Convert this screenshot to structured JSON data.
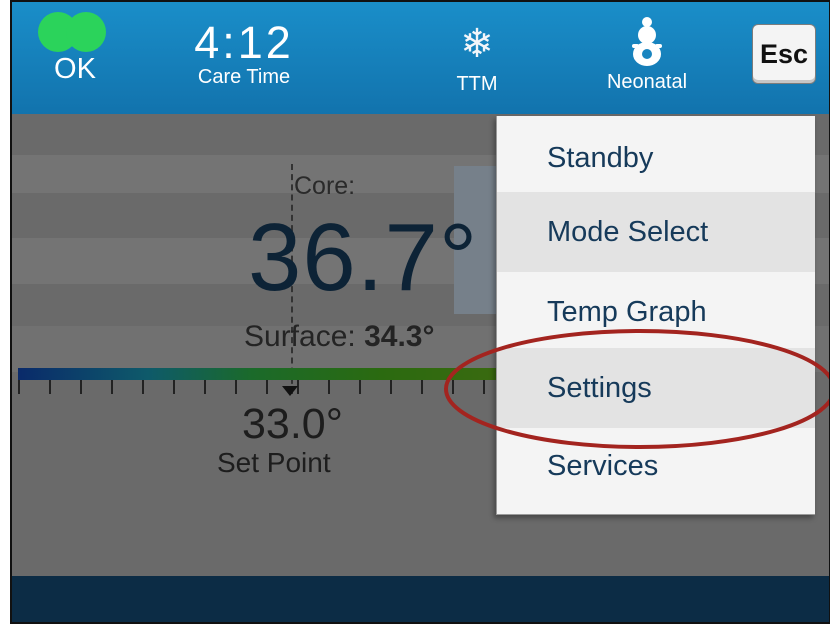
{
  "header": {
    "status_label": "OK",
    "status_color": "#2bd35b",
    "care_time_value": "4:12",
    "care_time_label": "Care Time",
    "mode_icon": "snowflake-icon",
    "mode_glyph": "❄",
    "mode_label": "TTM",
    "patient_icon": "baby-icon",
    "patient_label": "Neonatal",
    "esc_label": "Esc"
  },
  "main": {
    "core_label": "Core:",
    "core_value": "36.7°",
    "surface_label": "Surface:",
    "surface_value": "34.3°",
    "set_point_value": "33.0°",
    "set_point_label": "Set Point"
  },
  "menu": {
    "items": [
      {
        "label": "Standby"
      },
      {
        "label": "Mode Select"
      },
      {
        "label": "Temp Graph"
      },
      {
        "label": "Settings"
      },
      {
        "label": "Services"
      }
    ],
    "highlighted": "Settings",
    "highlight_color": "#a3241f"
  },
  "colors": {
    "header": "#1a8ec9",
    "bottom_bar": "#0c2c45",
    "menu_text": "#163a5a"
  }
}
